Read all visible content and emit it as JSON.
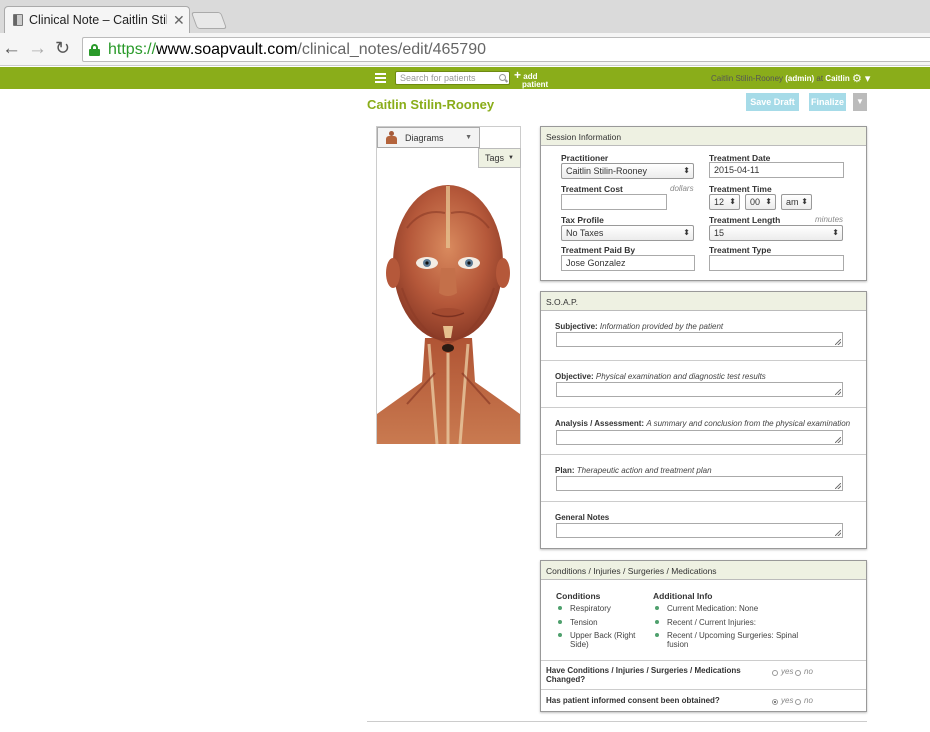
{
  "browser": {
    "tab_title": "Clinical Note – Caitlin Stilin",
    "url_scheme": "https://",
    "url_host": "www.soapvault.com",
    "url_path": "/clinical_notes/edit/465790"
  },
  "header": {
    "search_placeholder": "Search for patients",
    "add_label": "add",
    "add_label2": "patient",
    "user_name": "Caitlin Stilin-Rooney",
    "user_role": "(admin)",
    "at": "at",
    "clinic": "Caitlin",
    "accent_color": "#8aad1a"
  },
  "page": {
    "patient_name": "Caitlin Stilin-Rooney",
    "save_draft": "Save Draft",
    "finalize": "Finalize"
  },
  "diagrams": {
    "select_label": "Diagrams",
    "tags_label": "Tags"
  },
  "session": {
    "title": "Session Information",
    "practitioner_label": "Practitioner",
    "practitioner_value": "Caitlin Stilin-Rooney",
    "date_label": "Treatment Date",
    "date_value": "2015-04-11",
    "cost_label": "Treatment Cost",
    "cost_unit": "dollars",
    "cost_value": "",
    "time_label": "Treatment Time",
    "time_hour": "12",
    "time_min": "00",
    "time_ampm": "am",
    "tax_label": "Tax Profile",
    "tax_value": "No Taxes",
    "length_label": "Treatment Length",
    "length_unit": "minutes",
    "length_value": "15",
    "paid_by_label": "Treatment Paid By",
    "paid_by_value": "Jose Gonzalez",
    "type_label": "Treatment Type",
    "type_value": ""
  },
  "soap": {
    "title": "S.O.A.P.",
    "rows": [
      {
        "label": "Subjective:",
        "hint": "Information provided by the patient"
      },
      {
        "label": "Objective:",
        "hint": "Physical examination and diagnostic test results"
      },
      {
        "label": "Analysis / Assessment:",
        "hint": "A summary and conclusion from the physical examination"
      },
      {
        "label": "Plan:",
        "hint": "Therapeutic action and treatment plan"
      },
      {
        "label": "General Notes",
        "hint": ""
      }
    ]
  },
  "conditions": {
    "title": "Conditions / Injuries / Surgeries / Medications",
    "col1_title": "Conditions",
    "col1_items": [
      "Respiratory",
      "Tension",
      "Upper Back (Right",
      "Side)"
    ],
    "col2_title": "Additional Info",
    "col2_items": [
      "Current Medication: None",
      "Recent / Current Injuries:",
      "Recent / Upcoming Surgeries: Spinal",
      "fusion"
    ],
    "q1_line1": "Have Conditions / Injuries / Surgeries / Medications",
    "q1_line2": "Changed?",
    "q2": "Has patient informed consent been obtained?",
    "yes": "yes",
    "no": "no"
  }
}
